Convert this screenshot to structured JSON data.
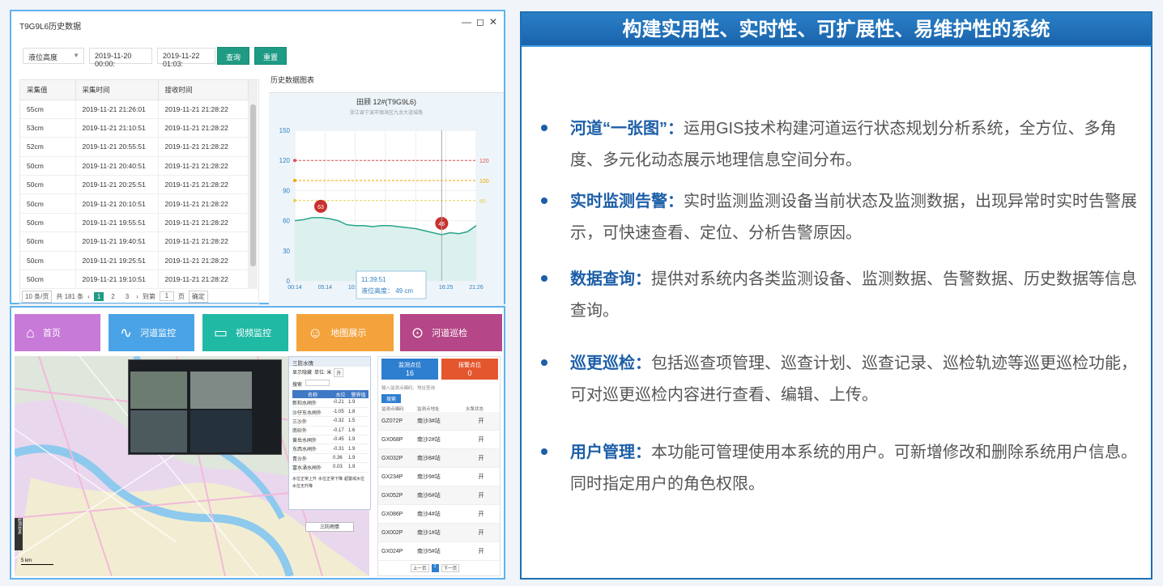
{
  "history_window": {
    "title": "T9G9L6历史数据",
    "controls": [
      "—",
      "◻",
      "✕"
    ],
    "filter": {
      "metric": "液位高度",
      "start": "2019-11-20 00:00:",
      "end": "2019-11-22 01:03:",
      "query_label": "查询",
      "reset_label": "重置"
    },
    "table": {
      "headers": [
        "采集值",
        "采集时间",
        "接收时间"
      ],
      "rows": [
        [
          "55cm",
          "2019-11-21 21:26:01",
          "2019-11-21 21:28:22"
        ],
        [
          "53cm",
          "2019-11-21 21:10:51",
          "2019-11-21 21:28:22"
        ],
        [
          "52cm",
          "2019-11-21 20:55:51",
          "2019-11-21 21:28:22"
        ],
        [
          "50cm",
          "2019-11-21 20:40:51",
          "2019-11-21 21:28:22"
        ],
        [
          "50cm",
          "2019-11-21 20:25:51",
          "2019-11-21 21:28:22"
        ],
        [
          "50cm",
          "2019-11-21 20:10:51",
          "2019-11-21 21:28:22"
        ],
        [
          "50cm",
          "2019-11-21 19:55:51",
          "2019-11-21 21:28:22"
        ],
        [
          "50cm",
          "2019-11-21 19:40:51",
          "2019-11-21 21:28:22"
        ],
        [
          "50cm",
          "2019-11-21 19:25:51",
          "2019-11-21 21:28:22"
        ],
        [
          "50cm",
          "2019-11-21 19:10:51",
          "2019-11-21 21:28:22"
        ]
      ]
    },
    "pager": {
      "page_size": "10 条/页",
      "total": "共 181 条",
      "pages": [
        "1",
        "2",
        "3"
      ],
      "goto": "到第",
      "page_input": "1",
      "unit": "页",
      "confirm": "确定"
    },
    "chart_panel_title": "历史数据图表"
  },
  "chart_data": {
    "type": "line",
    "title": "田顾 12#(T9G9L6)",
    "subtitle": "浙江省宁波市镇海区九龙大道城路",
    "x": [
      "00:14",
      "05:14",
      "10:18",
      "15:",
      "11:24",
      "16:25",
      "21:26"
    ],
    "ylim": [
      0,
      150
    ],
    "yticks": [
      "150",
      "120",
      "90",
      "60",
      "30",
      "0"
    ],
    "series": [
      {
        "values": [
          60,
          61,
          63,
          63,
          62,
          60,
          56,
          55,
          55,
          54,
          55,
          55,
          54,
          53,
          52,
          50,
          48,
          46,
          48,
          47,
          49,
          55
        ]
      }
    ],
    "thresholds": [
      {
        "value": 120,
        "label": "120",
        "color": "#d9534f"
      },
      {
        "value": 100,
        "label": "100",
        "color": "#f0a500"
      },
      {
        "value": 80,
        "label": "80",
        "color": "#e8d04a"
      }
    ],
    "markers": [
      {
        "label": "63",
        "value": 63
      },
      {
        "label": "46",
        "value": 46
      }
    ],
    "tooltip": {
      "time": "11:39:51",
      "text": "液位高度：  49 cm"
    }
  },
  "app": {
    "nav": [
      {
        "label": "首页",
        "icon": "home-icon",
        "color": "#c87ad8"
      },
      {
        "label": "河道监控",
        "icon": "monitor-icon",
        "color": "#4aa3e6"
      },
      {
        "label": "视频监控",
        "icon": "video-icon",
        "color": "#1fb9a4"
      },
      {
        "label": "地图展示",
        "icon": "map-person-icon",
        "color": "#f4a23b"
      },
      {
        "label": "河道巡检",
        "icon": "telescope-icon",
        "color": "#b54687"
      }
    ],
    "water_panel": {
      "title": "三防水情",
      "show_hidden": "显示隐藏",
      "unit": "单位: 米",
      "unit_value": "升",
      "search_label": "搜索",
      "headers": [
        "名称",
        "水位",
        "警界值"
      ],
      "rows": [
        [
          "新和水闸外",
          "-0.21",
          "1.9"
        ],
        [
          "沙仔东水闸外",
          "-1.05",
          "1.8"
        ],
        [
          "三沙外",
          "-0.32",
          "1.5"
        ],
        [
          "南砂外",
          "-0.17",
          "1.6"
        ],
        [
          "黄岳水闸外",
          "-0.45",
          "1.9"
        ],
        [
          "东西水闸外",
          "-0.31",
          "1.9"
        ],
        [
          "青沙外",
          "0.36",
          "1.9"
        ],
        [
          "富水涌水闸外",
          "0.03",
          "1.9"
        ]
      ],
      "legend": [
        "水位正常上升",
        "水位正常下降",
        "超警戒水位",
        "水位无升降"
      ],
      "button": "三防雨情"
    },
    "side_panel": {
      "stat1": {
        "label": "监测点位",
        "value": "16"
      },
      "stat2": {
        "label": "报警点位",
        "value": "0"
      },
      "search_placeholder": "输入监测点编码、地址查询",
      "search_btn": "搜索",
      "headers": [
        "监测点编码",
        "监测点地址",
        "水泵状态"
      ],
      "rows": [
        [
          "GZ072P",
          "南沙3#站",
          "开"
        ],
        [
          "GX068P",
          "南沙2#站",
          "开"
        ],
        [
          "GX032P",
          "南沙8#站",
          "开"
        ],
        [
          "GX234P",
          "南沙9#站",
          "开"
        ],
        [
          "GX052P",
          "南沙6#站",
          "开"
        ],
        [
          "GX086P",
          "南沙4#站",
          "开"
        ],
        [
          "GX002P",
          "南沙1#站",
          "开"
        ],
        [
          "GX024P",
          "南沙5#站",
          "开"
        ]
      ],
      "pager": [
        "上一页",
        "1",
        "下一页"
      ]
    },
    "map_scale": "5 km",
    "map_side_tab": "检测信息"
  },
  "intro": {
    "title": "构建实用性、实时性、可扩展性、易维护性的系统",
    "items": [
      {
        "head": "河道“一张图”：",
        "body": "运用GIS技术构建河道运行状态规划分析系统，全方位、多角度、多元化动态展示地理信息空间分布。"
      },
      {
        "head": "实时监测告警：",
        "body": "实时监测监测设备当前状态及监测数据，出现异常时实时告警展示，可快速查看、定位、分析告警原因。"
      },
      {
        "head": "数据查询：",
        "body": "提供对系统内各类监测设备、监测数据、告警数据、历史数据等信息查询。"
      },
      {
        "head": "巡更巡检：",
        "body": "包括巡查项管理、巡查计划、巡查记录、巡检轨迹等巡更巡检功能，可对巡更巡检内容进行查看、编辑、上传。"
      },
      {
        "head": "用户管理：",
        "body": "本功能可管理使用本系统的用户。可新增修改和删除系统用户信息。同时指定用户的角色权限。"
      }
    ]
  }
}
